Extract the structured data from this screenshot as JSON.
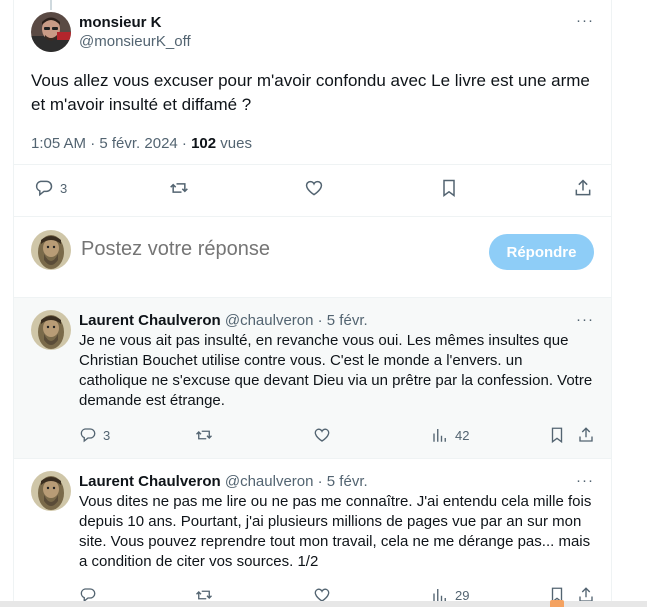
{
  "main_tweet": {
    "display_name": "monsieur K",
    "handle": "@monsieurK_off",
    "text": "Vous allez vous excuser pour m'avoir confondu avec Le livre est une arme et m'avoir insulté et diffamé ?",
    "time": "1:05 AM · 5 févr. 2024 · ",
    "views_count": "102",
    "views_label": " vues",
    "more_label": "···",
    "actions": {
      "replies": "3"
    }
  },
  "reply_box": {
    "placeholder": "Postez votre réponse",
    "button": "Répondre"
  },
  "replies": [
    {
      "display_name": "Laurent Chaulveron",
      "handle": "@chaulveron · 5 févr.",
      "text": "Je ne vous ait pas insulté, en revanche vous oui. Les mêmes insultes que Christian Bouchet utilise contre vous. C'est le monde a l'envers. un catholique ne s'excuse que devant Dieu via un prêtre par la confession. Votre demande est étrange.",
      "more_label": "···",
      "replies": "3",
      "views": "42"
    },
    {
      "display_name": "Laurent Chaulveron",
      "handle": "@chaulveron · 5 févr.",
      "text": "Vous dites ne pas me lire ou ne pas me connaître. J'ai entendu cela mille fois depuis 10 ans. Pourtant, j'ai plusieurs millions de pages vue par an sur mon site. Vous pouvez reprendre tout mon travail, cela ne me dérange pas... mais a condition de citer vos sources. 1/2",
      "more_label": "···",
      "replies": "",
      "views": "29"
    }
  ],
  "colors": {
    "text": "#0f1419",
    "muted": "#536471",
    "accent": "#1d9bf0",
    "accent_disabled": "#8ecdf7",
    "highlight_bg": "#f7f9f9"
  }
}
